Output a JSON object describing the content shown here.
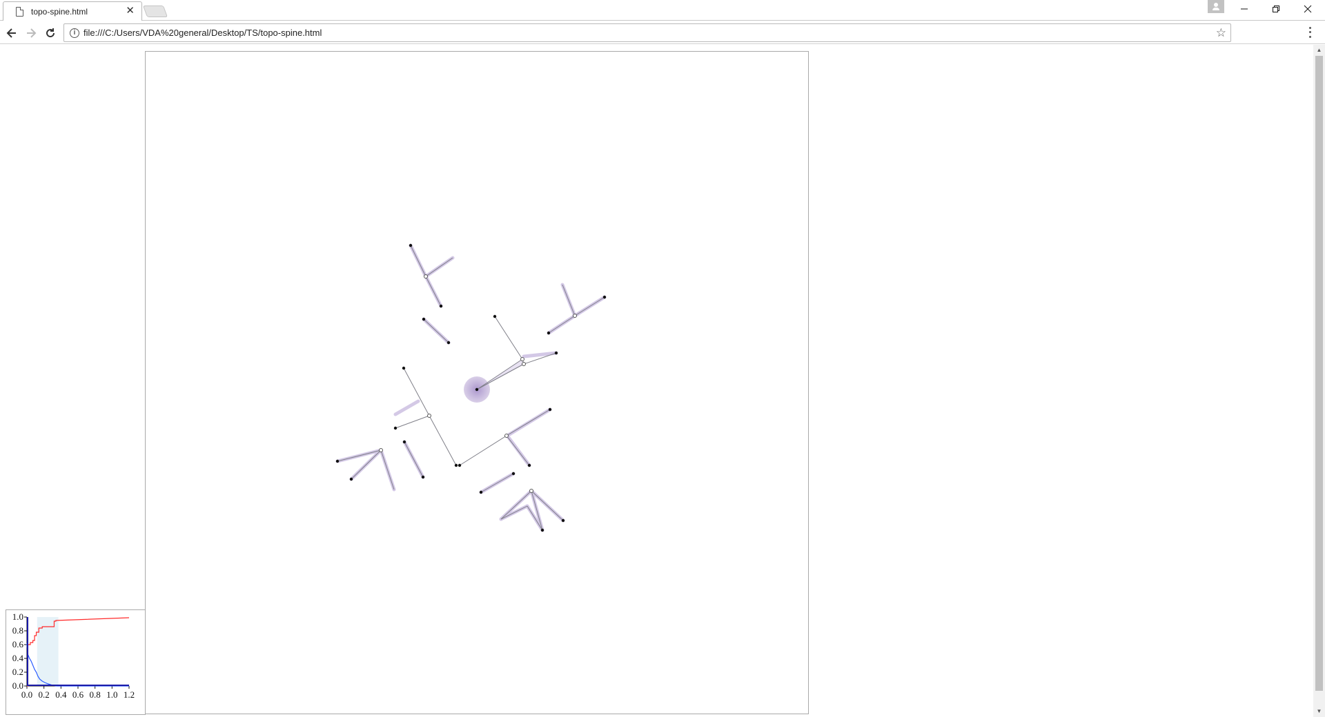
{
  "browser": {
    "tab_title": "topo-spine.html",
    "tab_close_glyph": "✕",
    "url": "file:///C:/Users/VDA%20general/Desktop/TS/topo-spine.html",
    "icons": [
      "doc-icon",
      "back-icon",
      "forward-icon",
      "reload-icon",
      "info-icon",
      "star-icon",
      "menu-icon",
      "profile-icon",
      "minimize-icon",
      "restore-icon",
      "close-icon"
    ]
  },
  "colors": {
    "edge": "#7f7f88",
    "halo": "#b9a6d4",
    "halo_strong": "#9c84c4",
    "node": "#111111",
    "cdf_red": "#ff2a2a",
    "cdf_blue": "#2a5bff",
    "axis_blue": "#1a1aa8",
    "band": "#e6f2f8"
  },
  "mini_chart": {
    "chart_data": {
      "type": "line",
      "x_ticks": [
        "0.0",
        "0.2",
        "0.4",
        "0.6",
        "0.8",
        "1.0",
        "1.2"
      ],
      "y_ticks": [
        "0.0",
        "0.2",
        "0.4",
        "0.6",
        "0.8",
        "1.0"
      ],
      "xlim": [
        0,
        1.2
      ],
      "ylim": [
        0,
        1
      ],
      "band": [
        0.12,
        0.37
      ],
      "series": [
        {
          "color": "#ff2a2a",
          "x": [
            0.0,
            0.01,
            0.01,
            0.04,
            0.04,
            0.07,
            0.07,
            0.09,
            0.09,
            0.11,
            0.11,
            0.14,
            0.14,
            0.18,
            0.18,
            0.32,
            0.32,
            0.34,
            0.34,
            1.2
          ],
          "y": [
            0.0,
            0.0,
            0.6,
            0.6,
            0.63,
            0.63,
            0.66,
            0.66,
            0.73,
            0.73,
            0.78,
            0.78,
            0.84,
            0.84,
            0.86,
            0.86,
            0.94,
            0.94,
            0.95,
            0.99
          ]
        },
        {
          "color": "#2a5bff",
          "x": [
            0.0,
            0.01,
            0.03,
            0.05,
            0.07,
            0.09,
            0.11,
            0.13,
            0.15,
            0.18,
            0.21,
            0.25,
            0.3,
            0.35,
            0.4,
            1.2
          ],
          "y": [
            0.62,
            0.46,
            0.4,
            0.36,
            0.3,
            0.24,
            0.2,
            0.14,
            0.1,
            0.07,
            0.05,
            0.03,
            0.01,
            0.0,
            0.0,
            0.0
          ]
        }
      ]
    }
  }
}
